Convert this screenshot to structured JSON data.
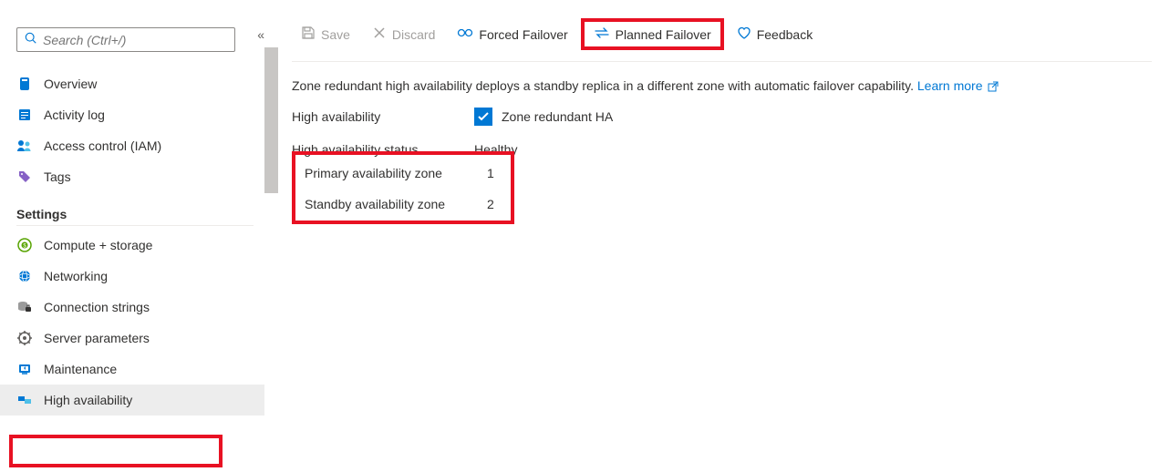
{
  "search": {
    "placeholder": "Search (Ctrl+/)"
  },
  "nav": {
    "items": [
      {
        "label": "Overview"
      },
      {
        "label": "Activity log"
      },
      {
        "label": "Access control (IAM)"
      },
      {
        "label": "Tags"
      }
    ],
    "settings_header": "Settings",
    "settings_items": [
      {
        "label": "Compute + storage"
      },
      {
        "label": "Networking"
      },
      {
        "label": "Connection strings"
      },
      {
        "label": "Server parameters"
      },
      {
        "label": "Maintenance"
      },
      {
        "label": "High availability"
      }
    ]
  },
  "toolbar": {
    "save": "Save",
    "discard": "Discard",
    "forced_failover": "Forced Failover",
    "planned_failover": "Planned Failover",
    "feedback": "Feedback"
  },
  "content": {
    "description": "Zone redundant high availability deploys a standby replica in a different zone with automatic failover capability.",
    "learn_more": "Learn more",
    "rows": {
      "ha_label": "High availability",
      "ha_checkbox_label": "Zone redundant HA",
      "status_label": "High availability status",
      "status_value": "Healthy",
      "primary_label": "Primary availability zone",
      "primary_value": "1",
      "standby_label": "Standby availability zone",
      "standby_value": "2"
    }
  }
}
